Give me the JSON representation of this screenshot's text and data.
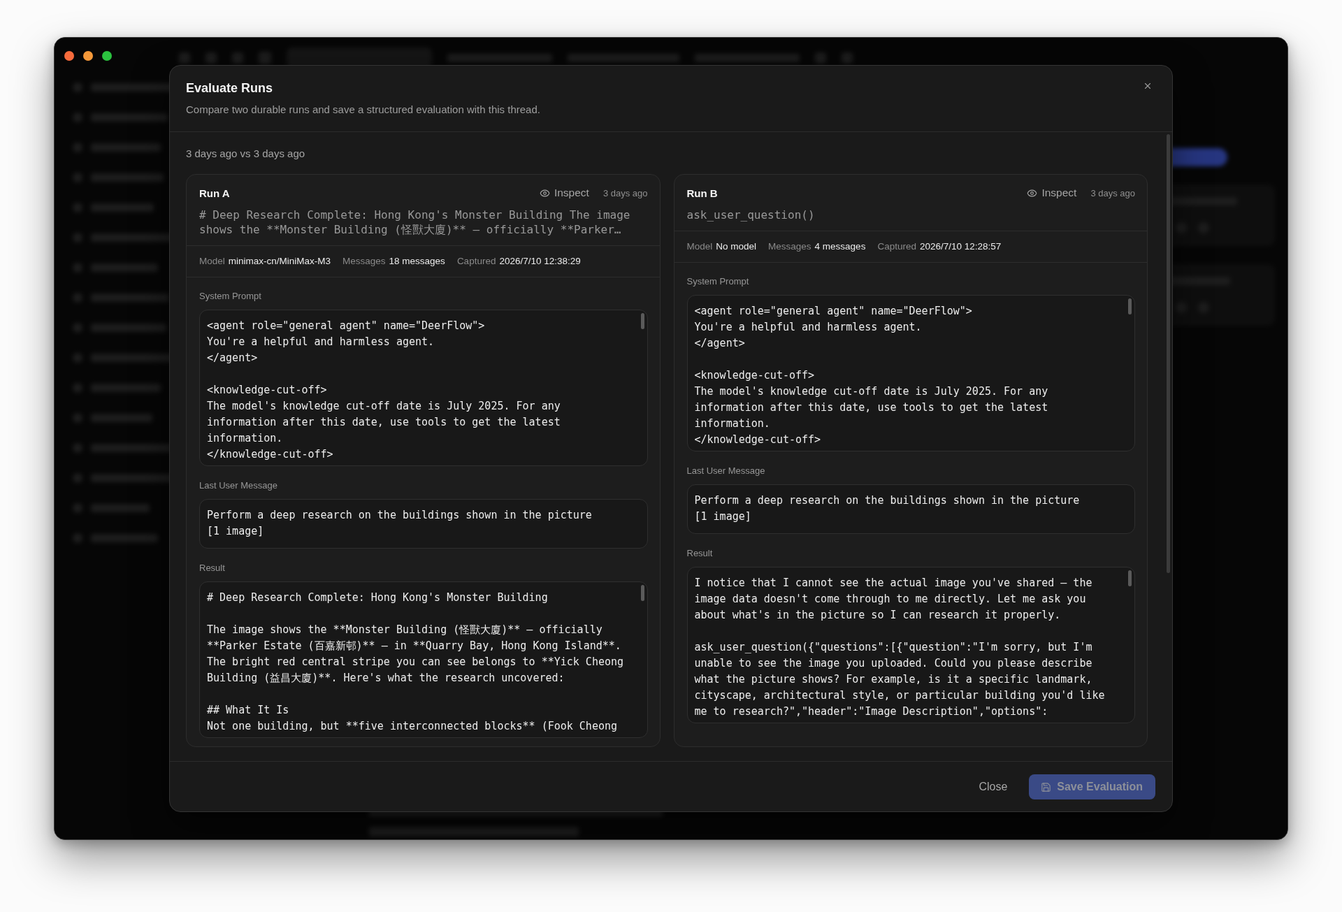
{
  "dialog": {
    "title": "Evaluate Runs",
    "subtitle": "Compare two durable runs and save a structured evaluation with this thread.",
    "comparison": "3 days ago vs 3 days ago",
    "runs": [
      {
        "name": "Run A",
        "inspect": "Inspect",
        "time": "3 days ago",
        "preview": "# Deep Research Complete: Hong Kong's Monster Building The image shows the **Monster Building (怪獸大廈)** — officially **Parker…",
        "meta": [
          {
            "label": "Model",
            "value": "minimax-cn/MiniMax-M3"
          },
          {
            "label": "Messages",
            "value": "18 messages"
          },
          {
            "label": "Captured",
            "value": "2026/7/10 12:38:29"
          }
        ],
        "sections": [
          {
            "label": "System Prompt",
            "kind": "scrollable",
            "text": "<agent role=\"general agent\" name=\"DeerFlow\">\nYou're a helpful and harmless agent.\n</agent>\n\n<knowledge-cut-off>\nThe model's knowledge cut-off date is July 2025. For any\ninformation after this date, use tools to get the latest\ninformation.\n</knowledge-cut-off>"
          },
          {
            "label": "Last User Message",
            "kind": "plain",
            "text": "Perform a deep research on the buildings shown in the picture\n[1 image]"
          },
          {
            "label": "Result",
            "kind": "scrollable",
            "text": "# Deep Research Complete: Hong Kong's Monster Building\n\nThe image shows the **Monster Building (怪獸大廈)** — officially\n**Parker Estate (百嘉新邨)** — in **Quarry Bay, Hong Kong Island**.\nThe bright red central stripe you can see belongs to **Yick Cheong\nBuilding (益昌大廈)**. Here's what the research uncovered:\n\n## What It Is\nNot one building, but **five interconnected blocks** (Fook Cheong"
          }
        ]
      },
      {
        "name": "Run B",
        "inspect": "Inspect",
        "time": "3 days ago",
        "preview": "ask_user_question()",
        "meta": [
          {
            "label": "Model",
            "value": "No model"
          },
          {
            "label": "Messages",
            "value": "4 messages"
          },
          {
            "label": "Captured",
            "value": "2026/7/10 12:28:57"
          }
        ],
        "sections": [
          {
            "label": "System Prompt",
            "kind": "scrollable",
            "text": "<agent role=\"general agent\" name=\"DeerFlow\">\nYou're a helpful and harmless agent.\n</agent>\n\n<knowledge-cut-off>\nThe model's knowledge cut-off date is July 2025. For any\ninformation after this date, use tools to get the latest\ninformation.\n</knowledge-cut-off>"
          },
          {
            "label": "Last User Message",
            "kind": "plain",
            "text": "Perform a deep research on the buildings shown in the picture\n[1 image]"
          },
          {
            "label": "Result",
            "kind": "scrollable",
            "text": "I notice that I cannot see the actual image you've shared — the\nimage data doesn't come through to me directly. Let me ask you\nabout what's in the picture so I can research it properly.\n\nask_user_question({\"questions\":[{\"question\":\"I'm sorry, but I'm\nunable to see the image you uploaded. Could you please describe\nwhat the picture shows? For example, is it a specific landmark,\ncityscape, architectural style, or particular building you'd like\nme to research?\",\"header\":\"Image Description\",\"options\":"
          }
        ]
      }
    ],
    "buttons": [
      {
        "label": "Close",
        "kind": "ghost",
        "disabled": false
      },
      {
        "label": "Save Evaluation",
        "kind": "primary",
        "disabled": true
      }
    ]
  }
}
